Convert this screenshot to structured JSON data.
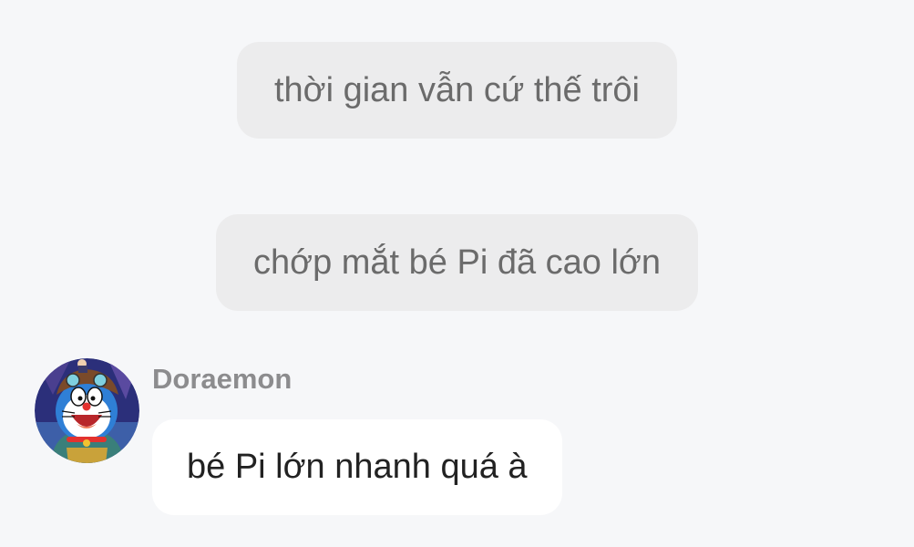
{
  "chat": {
    "messages": [
      {
        "type": "system-centered",
        "text": "thời gian vẫn cứ thế trôi"
      },
      {
        "type": "system-centered",
        "text": "chớp mắt bé Pi đã cao lớn"
      },
      {
        "type": "incoming",
        "sender": "Doraemon",
        "avatar_icon": "doraemon-avatar-icon",
        "text": "bé Pi lớn nhanh quá à"
      }
    ]
  },
  "colors": {
    "background": "#f6f7f9",
    "gray_bubble": "#ececed",
    "gray_text": "#6b6b6b",
    "white_bubble": "#ffffff",
    "sender_name": "#8c8c8e"
  }
}
